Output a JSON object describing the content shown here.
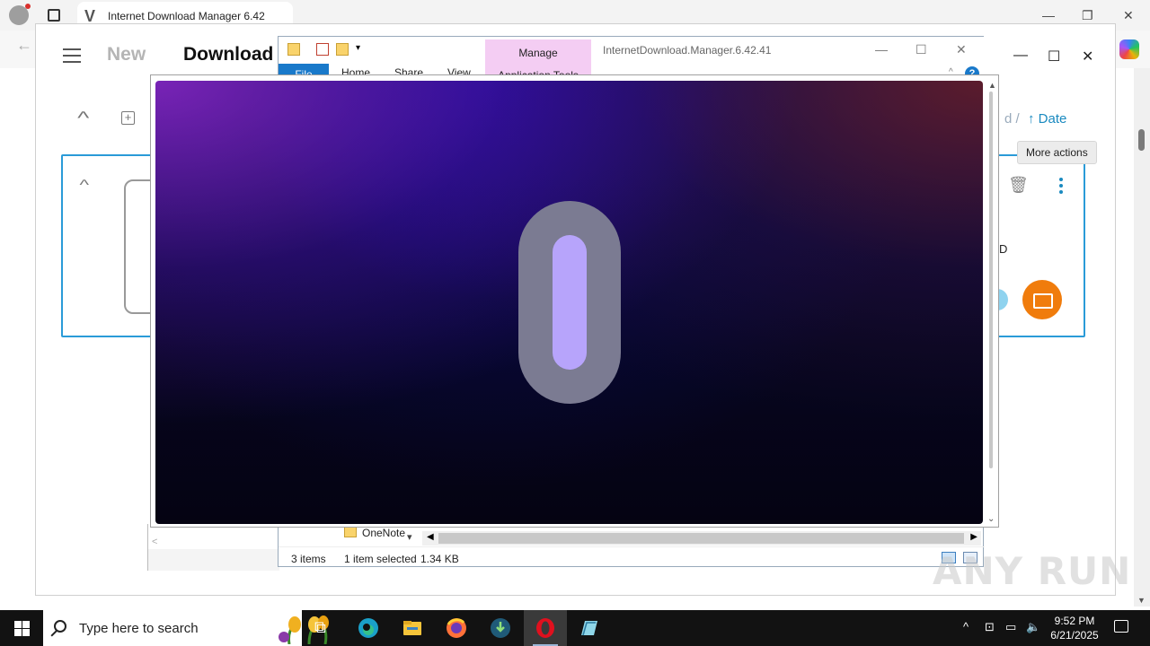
{
  "browser": {
    "tab_title": "Internet Download Manager 6.42",
    "tab_v": "V"
  },
  "app": {
    "new_label": "New",
    "downloads_label": "Download",
    "sort_sep": "d  /",
    "sort_date": "↑ Date",
    "card_d": "D",
    "tooltip": "More actions"
  },
  "explorer": {
    "title": "InternetDownload.Manager.6.42.41",
    "manage_tab": "Manage",
    "app_tools_tab": "Application Tools",
    "tabs": [
      "File",
      "Home",
      "Share",
      "View"
    ],
    "help": "?",
    "nav_item": "OneNote",
    "status": {
      "items": "3 items",
      "selected": "1 item selected",
      "size": "1.34 KB"
    }
  },
  "watermark": "ANY RUN",
  "taskbar": {
    "search_placeholder": "Type here to search",
    "time": "9:52 PM",
    "date": "6/21/2025"
  },
  "colors": {
    "accent_blue": "#2a9bd8",
    "folder_orange": "#f07c0c",
    "manage_pink": "#f4cdf3",
    "logo_gray": "#7b7b92",
    "logo_violet": "#b7a4fb"
  }
}
